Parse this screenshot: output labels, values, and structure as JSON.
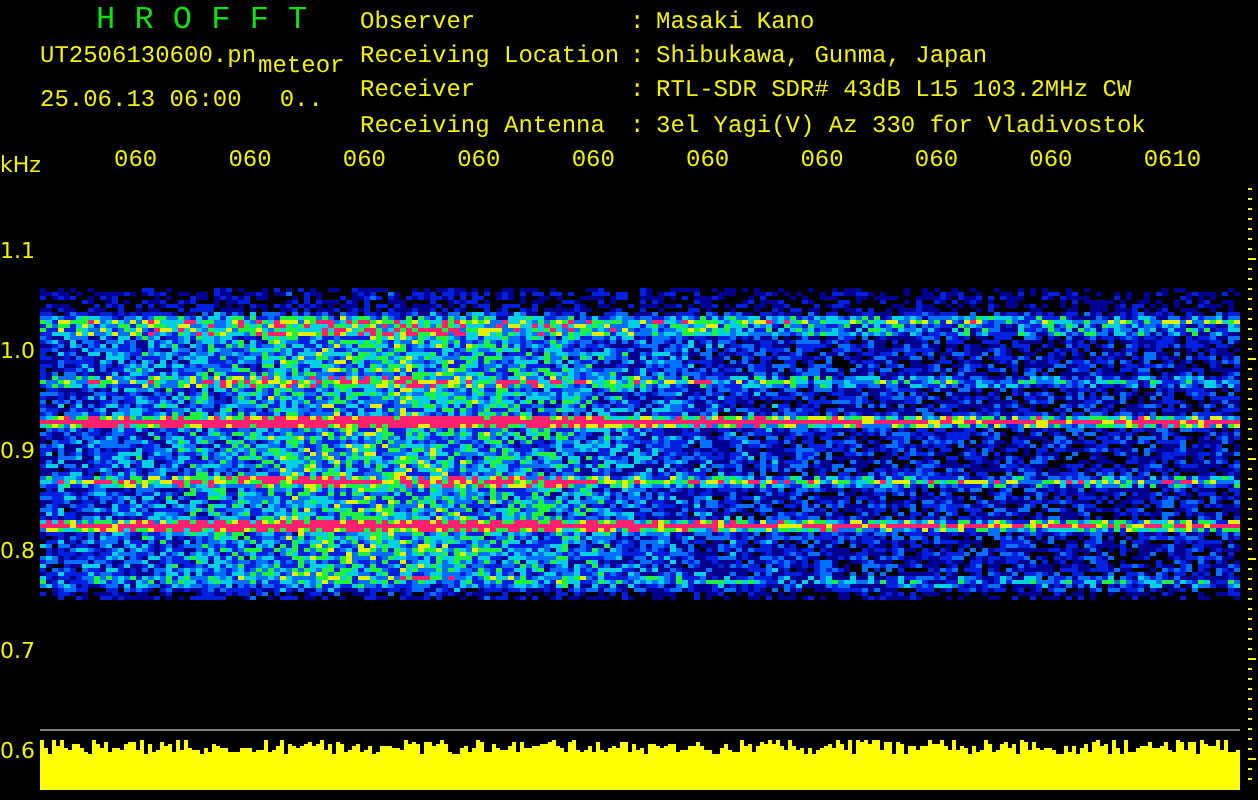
{
  "app_title": "H R O F F T",
  "file": {
    "name": "UT2506130600.pn",
    "tag": "meteor"
  },
  "timestamp": "25.06.13 06:00",
  "counter": "0..",
  "info": [
    {
      "label": "Observer",
      "separator": ":",
      "value": "Masaki Kano"
    },
    {
      "label": "Receiving Location",
      "separator": ":",
      "value": "Shibukawa, Gunma, Japan"
    },
    {
      "label": "Receiver",
      "separator": ":",
      "value": "RTL-SDR SDR# 43dB L15 103.2MHz CW"
    },
    {
      "label": "Receiving Antenna",
      "separator": ":",
      "value": "3el Yagi(V) Az 330 for Vladivostok"
    }
  ],
  "time_axis": {
    "labels": [
      "060",
      "060",
      "060",
      "060",
      "060",
      "060",
      "060",
      "060",
      "060",
      "0610"
    ]
  },
  "frequency_axis": {
    "unit": "kHz",
    "labels": [
      "1.1",
      "1.0",
      "0.9",
      "0.8",
      "0.7",
      "0.6"
    ]
  }
}
